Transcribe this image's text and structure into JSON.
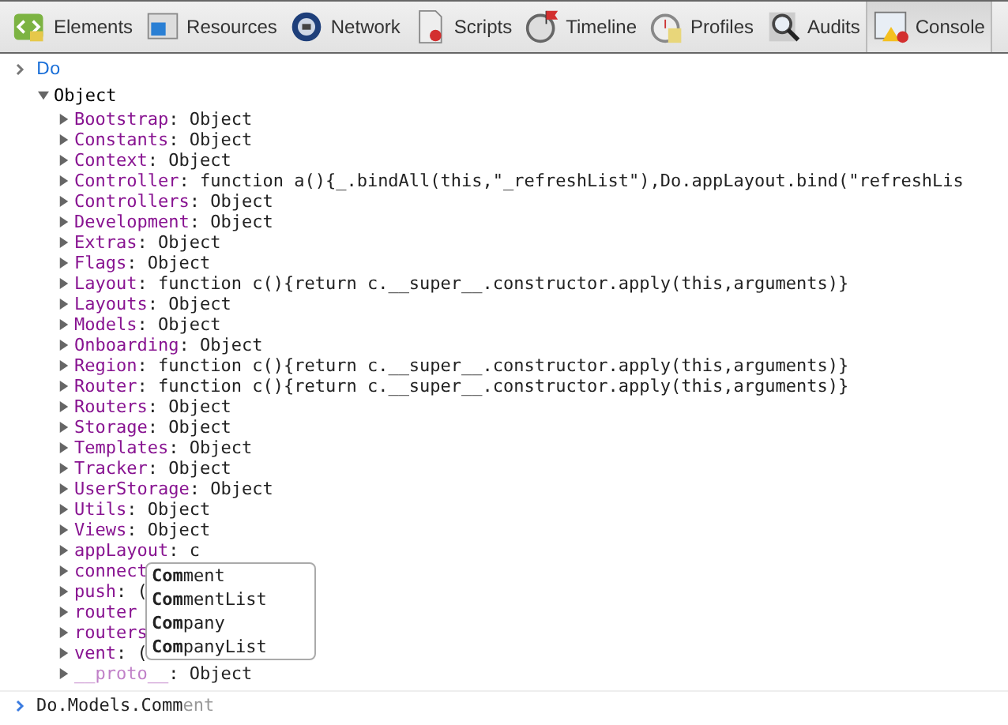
{
  "toolbar": {
    "tabs": [
      {
        "label": "Elements",
        "selected": false
      },
      {
        "label": "Resources",
        "selected": false
      },
      {
        "label": "Network",
        "selected": false
      },
      {
        "label": "Scripts",
        "selected": false
      },
      {
        "label": "Timeline",
        "selected": false
      },
      {
        "label": "Profiles",
        "selected": false
      },
      {
        "label": "Audits",
        "selected": false
      },
      {
        "label": "Console",
        "selected": true
      }
    ]
  },
  "console": {
    "command": "Do",
    "result": {
      "label": "Object",
      "expanded": true,
      "children": [
        {
          "name": "Bootstrap",
          "value": ": Object",
          "kind": "property",
          "expanded": false
        },
        {
          "name": "Constants",
          "value": ": Object",
          "kind": "property",
          "expanded": false
        },
        {
          "name": "Context",
          "value": ": Object",
          "kind": "property",
          "expanded": false
        },
        {
          "name": "Controller",
          "value": ": function a(){_.bindAll(this,\"_refreshList\"),Do.appLayout.bind(\"refreshLis",
          "kind": "property",
          "expanded": false
        },
        {
          "name": "Controllers",
          "value": ": Object",
          "kind": "property",
          "expanded": false
        },
        {
          "name": "Development",
          "value": ": Object",
          "kind": "property",
          "expanded": false
        },
        {
          "name": "Extras",
          "value": ": Object",
          "kind": "property",
          "expanded": false
        },
        {
          "name": "Flags",
          "value": ": Object",
          "kind": "property",
          "expanded": false
        },
        {
          "name": "Layout",
          "value": ": function c(){return c.__super__.constructor.apply(this,arguments)}",
          "kind": "property",
          "expanded": false
        },
        {
          "name": "Layouts",
          "value": ": Object",
          "kind": "property",
          "expanded": false
        },
        {
          "name": "Models",
          "value": ": Object",
          "kind": "property",
          "expanded": false
        },
        {
          "name": "Onboarding",
          "value": ": Object",
          "kind": "property",
          "expanded": false
        },
        {
          "name": "Region",
          "value": ": function c(){return c.__super__.constructor.apply(this,arguments)}",
          "kind": "property",
          "expanded": false
        },
        {
          "name": "Router",
          "value": ": function c(){return c.__super__.constructor.apply(this,arguments)}",
          "kind": "property",
          "expanded": false
        },
        {
          "name": "Routers",
          "value": ": Object",
          "kind": "property",
          "expanded": false
        },
        {
          "name": "Storage",
          "value": ": Object",
          "kind": "property",
          "expanded": false
        },
        {
          "name": "Templates",
          "value": ": Object",
          "kind": "property",
          "expanded": false
        },
        {
          "name": "Tracker",
          "value": ": Object",
          "kind": "property",
          "expanded": false
        },
        {
          "name": "UserStorage",
          "value": ": Object",
          "kind": "property",
          "expanded": false
        },
        {
          "name": "Utils",
          "value": ": Object",
          "kind": "property",
          "expanded": false
        },
        {
          "name": "Views",
          "value": ": Object",
          "kind": "property",
          "expanded": false
        },
        {
          "name": "appLayout",
          "value": ": c",
          "kind": "property",
          "expanded": false
        },
        {
          "name": "connect",
          "kind": "property",
          "expanded": false
        },
        {
          "name": "push",
          "value": ": (",
          "kind": "property",
          "expanded": false
        },
        {
          "name": "router",
          "kind": "property",
          "expanded": false
        },
        {
          "name": "routers",
          "kind": "property",
          "expanded": false
        },
        {
          "name": "vent",
          "value": ": (",
          "kind": "property",
          "expanded": false
        },
        {
          "name": "__proto__",
          "value": ": Object",
          "kind": "proto",
          "expanded": false
        }
      ]
    },
    "input": {
      "typed": "Do.Models.Comm",
      "hint": "ent"
    },
    "autocomplete": [
      "**Com**ment",
      "**Com**mentList",
      "**Com**pany",
      "**Com**panyList"
    ]
  }
}
